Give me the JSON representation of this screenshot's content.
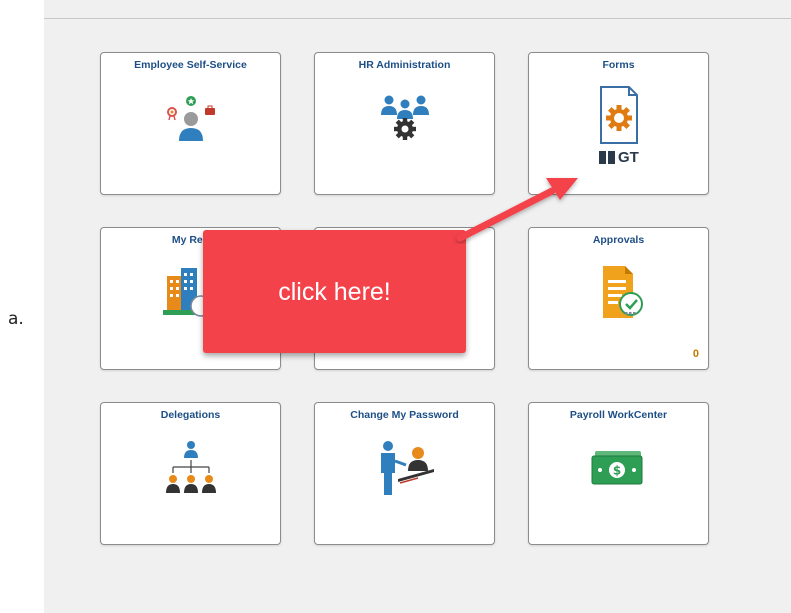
{
  "list_marker": "a.",
  "tiles": [
    {
      "title": "Employee Self-Service",
      "icon": "employee-self-service-icon"
    },
    {
      "title": "HR Administration",
      "icon": "hr-administration-icon"
    },
    {
      "title": "Forms",
      "icon": "forms-document-gear-icon",
      "logo_text": "GT"
    },
    {
      "title": "My Rep",
      "icon": "buildings-icon"
    },
    {
      "title": "",
      "icon": ""
    },
    {
      "title": "Approvals",
      "icon": "approvals-document-check-icon",
      "badge": "0"
    },
    {
      "title": "Delegations",
      "icon": "org-chart-icon"
    },
    {
      "title": "Change My Password",
      "icon": "password-user-icon"
    },
    {
      "title": "Payroll WorkCenter",
      "icon": "money-icon"
    }
  ],
  "callout": {
    "text": "click here!"
  },
  "colors": {
    "tile_title": "#1d4f86",
    "callout": "#f4424b",
    "badge": "#c47a00",
    "icon_blue": "#2f7ebd",
    "icon_orange": "#e88a1a",
    "icon_green": "#2e9e55"
  }
}
